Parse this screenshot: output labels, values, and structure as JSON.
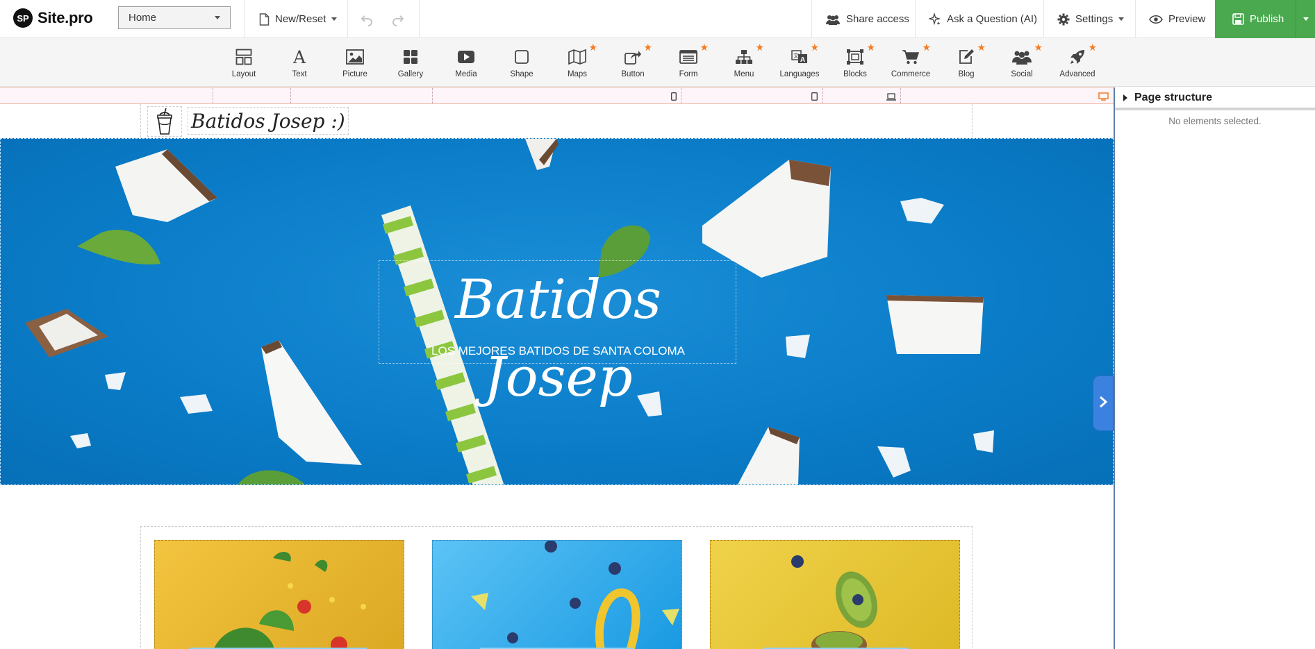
{
  "app": {
    "name": "Site.pro",
    "logo_initials": "SP"
  },
  "topbar": {
    "page_select": "Home",
    "new_reset": "New/Reset",
    "share_access": "Share access",
    "ask_question": "Ask a Question (AI)",
    "settings": "Settings",
    "preview": "Preview",
    "publish": "Publish"
  },
  "toolbar": {
    "items": [
      {
        "label": "Layout",
        "icon": "layout-icon",
        "premium": false
      },
      {
        "label": "Text",
        "icon": "text-icon",
        "premium": false
      },
      {
        "label": "Picture",
        "icon": "picture-icon",
        "premium": false
      },
      {
        "label": "Gallery",
        "icon": "gallery-icon",
        "premium": false
      },
      {
        "label": "Media",
        "icon": "media-icon",
        "premium": false
      },
      {
        "label": "Shape",
        "icon": "shape-icon",
        "premium": false
      },
      {
        "label": "Maps",
        "icon": "map-icon",
        "premium": true
      },
      {
        "label": "Button",
        "icon": "button-share-icon",
        "premium": true
      },
      {
        "label": "Form",
        "icon": "form-icon",
        "premium": true
      },
      {
        "label": "Menu",
        "icon": "sitemap-icon",
        "premium": true
      },
      {
        "label": "Languages",
        "icon": "language-icon",
        "premium": true
      },
      {
        "label": "Blocks",
        "icon": "blocks-icon",
        "premium": true
      },
      {
        "label": "Commerce",
        "icon": "cart-icon",
        "premium": true
      },
      {
        "label": "Blog",
        "icon": "blog-edit-icon",
        "premium": true
      },
      {
        "label": "Social",
        "icon": "users-icon",
        "premium": true
      },
      {
        "label": "Advanced",
        "icon": "rocket-icon",
        "premium": true
      }
    ]
  },
  "colors": {
    "accent_star": "#f47b20",
    "publish_green": "#4aa84f",
    "hero_blue": "#0b7dc9"
  },
  "site": {
    "header_title": "Batidos Josep :)",
    "hero_title": "Batidos Josep",
    "hero_subtitle": "LOS MEJORES BATIDOS DE SANTA COLOMA"
  },
  "panel": {
    "title": "Page structure",
    "empty": "No elements selected."
  }
}
